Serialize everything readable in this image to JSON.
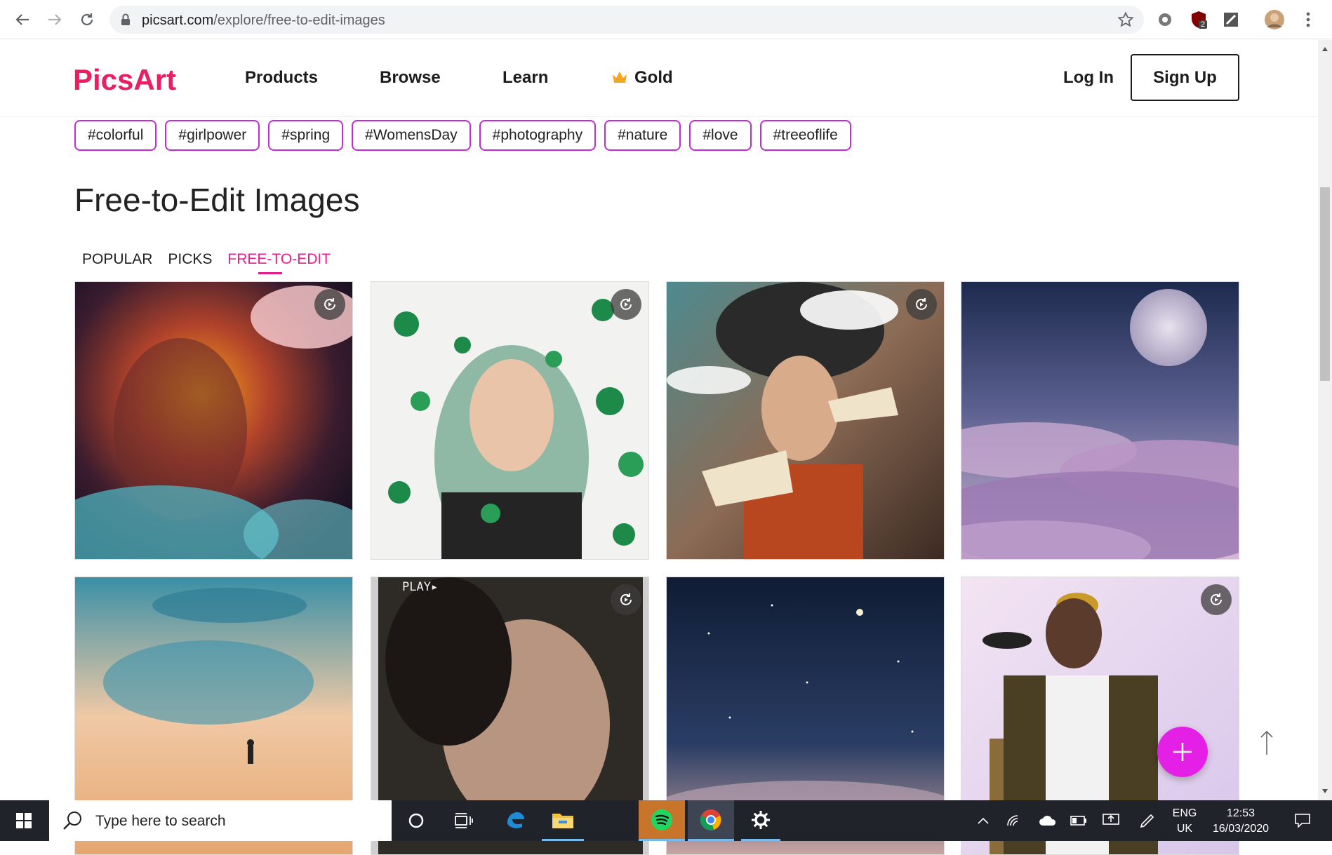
{
  "browser": {
    "url_domain": "picsart.com",
    "url_path": "/explore/free-to-edit-images",
    "extension_badge": "2"
  },
  "header": {
    "logo": "PicsArt",
    "nav": [
      "Products",
      "Browse",
      "Learn",
      "Gold"
    ],
    "login": "Log In",
    "signup": "Sign Up"
  },
  "tags": [
    "#colorful",
    "#girlpower",
    "#spring",
    "#WomensDay",
    "#photography",
    "#nature",
    "#love",
    "#treeoflife"
  ],
  "main": {
    "title": "Free-to-Edit Images",
    "tabs": [
      "POPULAR",
      "PICKS",
      "FREE-TO-EDIT"
    ],
    "active_tab": "FREE-TO-EDIT",
    "play_label": "PLAY▸"
  },
  "taskbar": {
    "search_placeholder": "Type here to search",
    "lang_top": "ENG",
    "lang_bottom": "UK",
    "time": "12:53",
    "date": "16/03/2020"
  },
  "colors": {
    "brand": "#e91e63",
    "tag_border": "#c02bd6",
    "active_tab": "#e91e8c",
    "fab": "#e520e6",
    "taskbar": "#20232a"
  }
}
